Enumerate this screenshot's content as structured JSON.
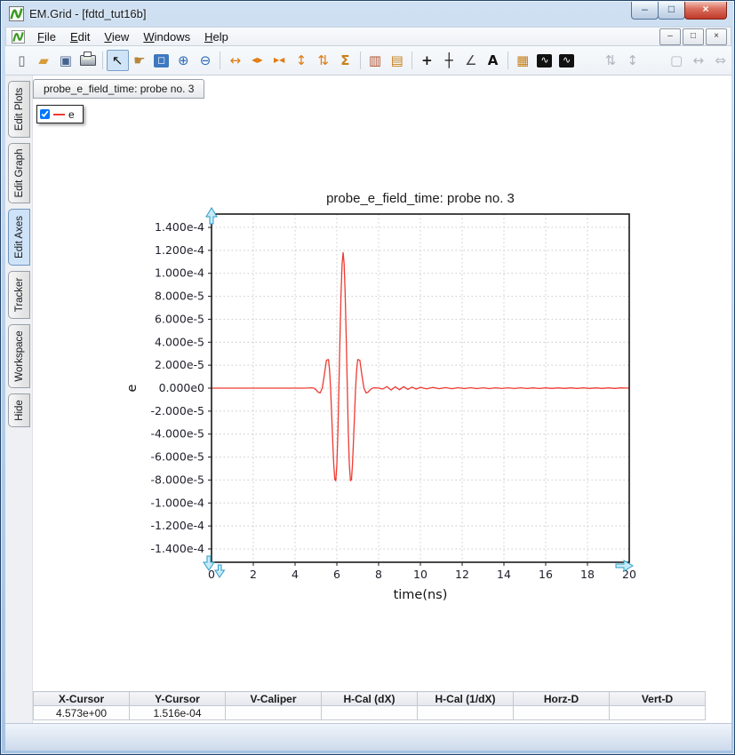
{
  "window": {
    "title": "EM.Grid - [fdtd_tut16b]",
    "controls": {
      "minimize": "–",
      "maximize": "□",
      "close": "×"
    },
    "mdi_controls": {
      "minimize": "–",
      "restore": "□",
      "close": "×"
    }
  },
  "menu": {
    "items": [
      "File",
      "Edit",
      "View",
      "Windows",
      "Help"
    ]
  },
  "toolbar": {
    "items": [
      {
        "name": "new-file",
        "glyph": "▯",
        "color": "#5a6572"
      },
      {
        "name": "open-folder",
        "glyph": "▰",
        "color": "#d89c3c"
      },
      {
        "name": "save",
        "glyph": "▣",
        "color": "#46628f"
      },
      {
        "name": "print",
        "glyph": "",
        "color": "#555555",
        "css": "printer"
      },
      {
        "name": "select-cursor",
        "glyph": "↖",
        "color": "#111111",
        "active": true,
        "sep_before": true
      },
      {
        "name": "pan-hand",
        "glyph": "☛",
        "color": "#b8863b"
      },
      {
        "name": "zoom-region",
        "glyph": "◻",
        "color": "#ffffff",
        "chip": "#3d78c0"
      },
      {
        "name": "zoom-in",
        "glyph": "⊕",
        "color": "#2f6bb5"
      },
      {
        "name": "zoom-out",
        "glyph": "⊖",
        "color": "#2f6bb5"
      },
      {
        "name": "fit-x",
        "glyph": "↔",
        "color": "#e07b10",
        "sep_before": true
      },
      {
        "name": "expand-x",
        "glyph": "◀▶",
        "color": "#e07b10",
        "small": true
      },
      {
        "name": "compress-x",
        "glyph": "▶◀",
        "color": "#e07b10",
        "small": true
      },
      {
        "name": "fit-y",
        "glyph": "↕",
        "color": "#e07b10"
      },
      {
        "name": "expand-y",
        "glyph": "⇅",
        "color": "#e07b10"
      },
      {
        "name": "autoscale",
        "glyph": "Σ",
        "color": "#c87f1a",
        "bold": true
      },
      {
        "name": "histogram-vertical",
        "glyph": "▥",
        "color": "#b3502e",
        "sep_before": true
      },
      {
        "name": "histogram-horizontal",
        "glyph": "▤",
        "color": "#c87f1a"
      },
      {
        "name": "crosshair",
        "glyph": "+",
        "color": "#1a1a1a",
        "bold": true,
        "sep_before": true
      },
      {
        "name": "tracker",
        "glyph": "┼",
        "color": "#1a1a1a"
      },
      {
        "name": "slope",
        "glyph": "∠",
        "color": "#444444"
      },
      {
        "name": "text-annotation",
        "glyph": "A",
        "color": "#111111",
        "bold": true
      },
      {
        "name": "new-plot",
        "glyph": "▦",
        "color": "#c87f1a",
        "sep_before": true
      },
      {
        "name": "fft-forward",
        "glyph": "∿",
        "color": "#ffffff",
        "chip": "#111111"
      },
      {
        "name": "fft-inverse",
        "glyph": "∿",
        "color": "#ffffff",
        "chip": "#111111"
      },
      {
        "name": "expand-frame-v",
        "glyph": "⇅",
        "color": "#b0b6bd",
        "disabled": true,
        "gap_before": true
      },
      {
        "name": "fit-frame-v",
        "glyph": "↕",
        "color": "#b0b6bd",
        "disabled": true
      },
      {
        "name": "frame",
        "glyph": "▢",
        "color": "#b0b6bd",
        "disabled": true,
        "gap_before": true
      },
      {
        "name": "expand-frame-h",
        "glyph": "↔",
        "color": "#b0b6bd",
        "disabled": true
      },
      {
        "name": "fit-frame-h",
        "glyph": "⇔",
        "color": "#b0b6bd",
        "disabled": true
      }
    ]
  },
  "sidebar": {
    "items": [
      {
        "label": "Edit Plots",
        "active": false
      },
      {
        "label": "Edit Graph",
        "active": false
      },
      {
        "label": "Edit Axes",
        "active": true
      },
      {
        "label": "Tracker",
        "active": false
      },
      {
        "label": "Workspace",
        "active": false
      },
      {
        "label": "Hide",
        "active": false
      }
    ]
  },
  "document_tab": {
    "label": "probe_e_field_time: probe no. 3"
  },
  "legend": {
    "label": "e",
    "checked": true,
    "line_color": "#ee3b32"
  },
  "chart_data": {
    "type": "line",
    "title": "probe_e_field_time: probe no. 3",
    "xlabel": "time(ns)",
    "ylabel": "e",
    "xlim": [
      0,
      20
    ],
    "ylim": [
      -0.0001516,
      0.0001516
    ],
    "grid": true,
    "legend_position": "top-left-floating",
    "x_ticks": [
      0,
      2,
      4,
      6,
      8,
      10,
      12,
      14,
      16,
      18,
      20
    ],
    "y_ticks": [
      {
        "v": 0.00014,
        "label": "1.400e-4"
      },
      {
        "v": 0.00012,
        "label": "1.200e-4"
      },
      {
        "v": 0.0001,
        "label": "1.000e-4"
      },
      {
        "v": 8e-05,
        "label": "8.000e-5"
      },
      {
        "v": 6e-05,
        "label": "6.000e-5"
      },
      {
        "v": 4e-05,
        "label": "4.000e-5"
      },
      {
        "v": 2e-05,
        "label": "2.000e-5"
      },
      {
        "v": 0,
        "label": "0.000e0"
      },
      {
        "v": -2e-05,
        "label": "-2.000e-5"
      },
      {
        "v": -4e-05,
        "label": "-4.000e-5"
      },
      {
        "v": -6e-05,
        "label": "-6.000e-5"
      },
      {
        "v": -8e-05,
        "label": "-8.000e-5"
      },
      {
        "v": -0.0001,
        "label": "-1.000e-4"
      },
      {
        "v": -0.00012,
        "label": "-1.200e-4"
      },
      {
        "v": -0.00014,
        "label": "-1.400e-4"
      }
    ],
    "series": [
      {
        "name": "e",
        "color": "#ee3b32",
        "points": [
          [
            0,
            0
          ],
          [
            0.5,
            0
          ],
          [
            1,
            0
          ],
          [
            1.5,
            0
          ],
          [
            2,
            0
          ],
          [
            2.5,
            0
          ],
          [
            3,
            0
          ],
          [
            3.5,
            0
          ],
          [
            4,
            0
          ],
          [
            4.4,
            0
          ],
          [
            4.6,
            1e-07
          ],
          [
            4.8,
            3e-07
          ],
          [
            4.9,
            0
          ],
          [
            5.0,
            -1.3e-06
          ],
          [
            5.1,
            -3.4e-06
          ],
          [
            5.2,
            -4.2e-06
          ],
          [
            5.3,
            0
          ],
          [
            5.4,
            1.13e-05
          ],
          [
            5.5,
            2.43e-05
          ],
          [
            5.6,
            2.49e-05
          ],
          [
            5.65,
            1.59e-05
          ],
          [
            5.7,
            0
          ],
          [
            5.75,
            -2.14e-05
          ],
          [
            5.8,
            -4.5e-05
          ],
          [
            5.85,
            -6.61e-05
          ],
          [
            5.9,
            -7.95e-05
          ],
          [
            5.95,
            -8.06e-05
          ],
          [
            6.0,
            -6.68e-05
          ],
          [
            6.05,
            -3.87e-05
          ],
          [
            6.1,
            0
          ],
          [
            6.15,
            4.27e-05
          ],
          [
            6.2,
            8.14e-05
          ],
          [
            6.25,
            0.0001083
          ],
          [
            6.3,
            0.000118
          ],
          [
            6.35,
            0.0001083
          ],
          [
            6.4,
            8.14e-05
          ],
          [
            6.45,
            4.27e-05
          ],
          [
            6.5,
            0
          ],
          [
            6.55,
            -3.87e-05
          ],
          [
            6.6,
            -6.68e-05
          ],
          [
            6.65,
            -8.06e-05
          ],
          [
            6.7,
            -7.95e-05
          ],
          [
            6.75,
            -6.61e-05
          ],
          [
            6.8,
            -4.5e-05
          ],
          [
            6.85,
            -2.14e-05
          ],
          [
            6.9,
            0
          ],
          [
            6.95,
            1.59e-05
          ],
          [
            7.0,
            2.49e-05
          ],
          [
            7.1,
            2.43e-05
          ],
          [
            7.2,
            1.13e-05
          ],
          [
            7.3,
            0
          ],
          [
            7.4,
            -4.2e-06
          ],
          [
            7.5,
            -3.4e-06
          ],
          [
            7.6,
            -1.3e-06
          ],
          [
            7.7,
            0
          ],
          [
            7.8,
            3e-07
          ],
          [
            8.0,
            1e-07
          ],
          [
            8.2,
            -8e-07
          ],
          [
            8.4,
            1.4e-06
          ],
          [
            8.6,
            -1.6e-06
          ],
          [
            8.8,
            1.2e-06
          ],
          [
            9.0,
            -1.4e-06
          ],
          [
            9.2,
            1.3e-06
          ],
          [
            9.4,
            -1.1e-06
          ],
          [
            9.6,
            9e-07
          ],
          [
            9.8,
            -8e-07
          ],
          [
            10,
            7e-07
          ],
          [
            10.3,
            -6e-07
          ],
          [
            10.6,
            6e-07
          ],
          [
            10.9,
            -5e-07
          ],
          [
            11.2,
            5e-07
          ],
          [
            11.5,
            -5e-07
          ],
          [
            11.8,
            4e-07
          ],
          [
            12.1,
            -4e-07
          ],
          [
            12.4,
            4e-07
          ],
          [
            12.7,
            -4e-07
          ],
          [
            13,
            3e-07
          ],
          [
            13.3,
            -4e-07
          ],
          [
            13.6,
            3e-07
          ],
          [
            13.9,
            -3e-07
          ],
          [
            14.2,
            3e-07
          ],
          [
            14.5,
            -3e-07
          ],
          [
            14.8,
            3e-07
          ],
          [
            15.1,
            -3e-07
          ],
          [
            15.4,
            2e-07
          ],
          [
            15.7,
            -3e-07
          ],
          [
            16,
            2e-07
          ],
          [
            16.3,
            -2e-07
          ],
          [
            16.6,
            2e-07
          ],
          [
            16.9,
            -2e-07
          ],
          [
            17.2,
            2e-07
          ],
          [
            17.5,
            -2e-07
          ],
          [
            17.8,
            2e-07
          ],
          [
            18.1,
            -2e-07
          ],
          [
            18.4,
            2e-07
          ],
          [
            18.7,
            -2e-07
          ],
          [
            19,
            2e-07
          ],
          [
            19.3,
            -2e-07
          ],
          [
            19.6,
            2e-07
          ],
          [
            20,
            0
          ]
        ]
      }
    ]
  },
  "status_table": {
    "headers": [
      "X-Cursor",
      "Y-Cursor",
      "V-Caliper",
      "H-Cal (dX)",
      "H-Cal (1/dX)",
      "Horz-D",
      "Vert-D"
    ],
    "values": [
      "4.573e+00",
      "1.516e-04",
      "",
      "",
      "",
      "",
      ""
    ]
  },
  "colors": {
    "series_red": "#ee3b32",
    "grid_grey": "#c9c9c9",
    "axis_black": "#1a1a1a",
    "handle_fill": "#c6ebf8",
    "handle_stroke": "#2e9cc4",
    "active_tab_blue": "#cfe3f8"
  }
}
